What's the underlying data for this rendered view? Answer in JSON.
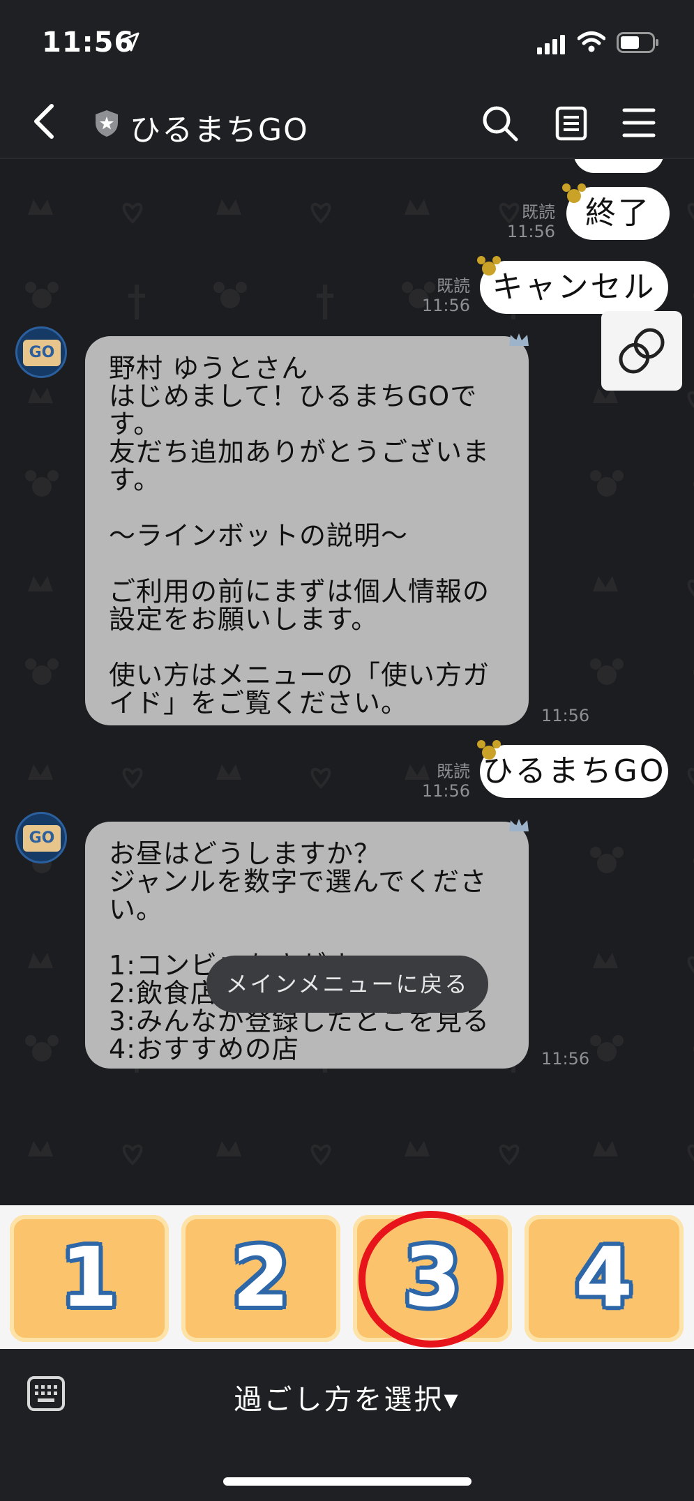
{
  "status": {
    "time": "11:56"
  },
  "header": {
    "title": "ひるまちGO"
  },
  "messages": {
    "out1": {
      "read": "既読",
      "time": "11:56",
      "text": "終了"
    },
    "out2": {
      "read": "既読",
      "time": "11:56",
      "text": "キャンセル"
    },
    "in1": {
      "text": "野村 ゆうとさん\nはじめまして！ひるまちGOです。\n友だち追加ありがとうございます。\n\n〜ラインボットの説明〜\n\nご利用の前にまずは個人情報の設定をお願いします。\n\n使い方はメニューの「使い方ガイド」をご覧ください。",
      "time": "11:56"
    },
    "out3": {
      "read": "既読",
      "time": "11:56",
      "text": "ひるまちGO"
    },
    "in2": {
      "text": "お昼はどうしますか？\nジャンルを数字で選んでください。\n\n1:コンビニをさがす\n2:飲食店をさがす\n3:みんなが登録したとこを見る\n4:おすすめの店",
      "time": "11:56"
    },
    "avatar_label": "GO"
  },
  "quick_reply": {
    "main_menu": "メインメニューに戻る"
  },
  "rich_menu": {
    "buttons": [
      "1",
      "2",
      "3",
      "4"
    ]
  },
  "bottom": {
    "selector_label": "過ごし方を選択▾"
  },
  "colors": {
    "bubble_in": "#b8b8b8",
    "tile": "#fbc36b",
    "highlight_circle": "#e8141c",
    "number_outline": "#2d67a8"
  },
  "icons": [
    "location-arrow-icon",
    "signal-icon",
    "wifi-icon",
    "battery-icon",
    "back-chevron-icon",
    "shield-icon",
    "search-icon",
    "note-icon",
    "hamburger-menu-icon",
    "link-icon",
    "keyboard-icon",
    "mickey-icon",
    "crown-icon"
  ]
}
